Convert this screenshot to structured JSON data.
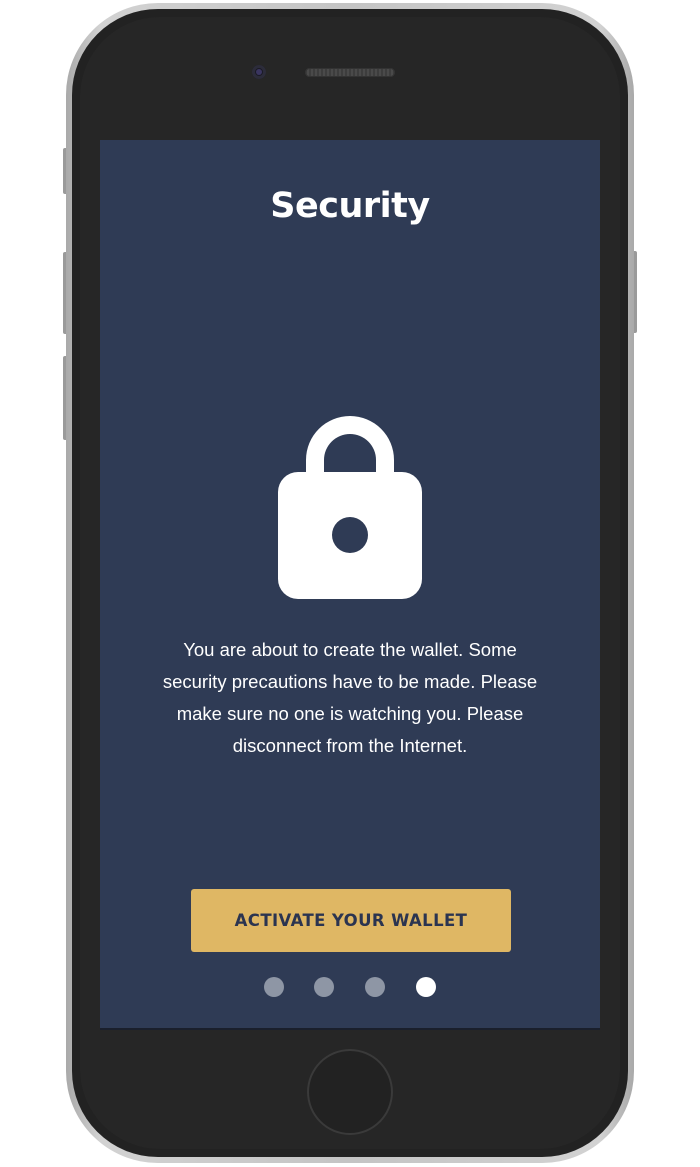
{
  "screen": {
    "title": "Security",
    "icon": "lock-icon",
    "message": "You are about to create the wallet. Some security precautions have to be made. Please make sure no one is watching you. Please disconnect from the Internet.",
    "cta_label": "ACTIVATE YOUR WALLET"
  },
  "pagination": {
    "total": 4,
    "active_index": 3
  },
  "colors": {
    "screen_background": "#2f3b55",
    "accent": "#dfb764",
    "cta_text": "#2b3450",
    "dot_inactive": "#8e96a5",
    "dot_active": "#ffffff"
  }
}
